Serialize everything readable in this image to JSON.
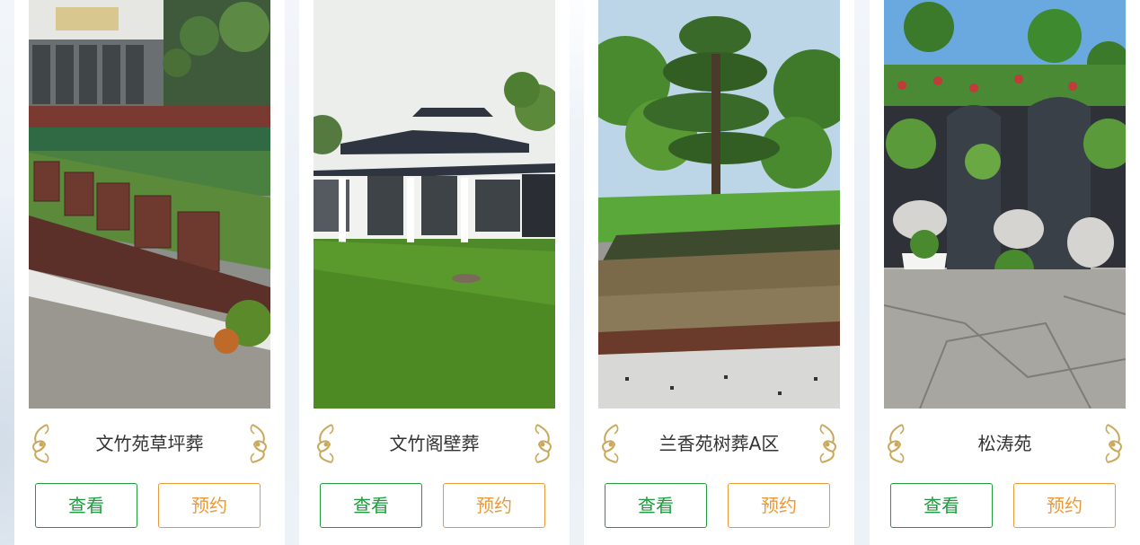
{
  "colors": {
    "view_accent": "#1f9a3e",
    "book_accent": "#ea9a3a",
    "ornament": "#c9a85a",
    "title_text": "#333333"
  },
  "cards": [
    {
      "photo": "lawn-burial-granite-plaques-photo",
      "title": "文竹苑草坪葬",
      "view_label": "查看",
      "book_label": "预约"
    },
    {
      "photo": "wall-niche-pavilion-lawn-photo",
      "title": "文竹阁壁葬",
      "view_label": "查看",
      "book_label": "预约"
    },
    {
      "photo": "tree-burial-pine-terrace-photo",
      "title": "兰香苑树葬A区",
      "view_label": "查看",
      "book_label": "预约"
    },
    {
      "photo": "stone-lion-niche-garden-photo",
      "title": "松涛苑",
      "view_label": "查看",
      "book_label": "预约"
    }
  ]
}
